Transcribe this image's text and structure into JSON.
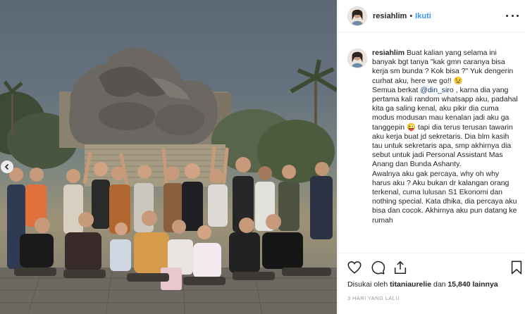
{
  "post": {
    "username": "resiahlim",
    "separator": "•",
    "follow_label": "Ikuti",
    "more_icon": "ellipsis-icon"
  },
  "caption": {
    "username": "resiahlim",
    "p1": " Buat kalian yang selama ini banyak bgt tanya \"kak gmn caranya bisa kerja sm bunda ? Kok bisa ?\" Yuk dengerin curhat aku, here we go!! 😉\nSemua berkat ",
    "mention": "@din_siro",
    "p2": " , karna dia yang pertama kali random whatsapp aku, padahal kita ga saling kenal, aku pikir dia cuma modus modusan mau kenalan jadi aku ga tanggepin 😜 tapi dia terus terusan tawarin aku kerja buat jd sekretaris. Dia blm kasih tau untuk sekretaris apa, smp akhirnya dia sebut untuk jadi Personal Assistant Mas Anang dan Bunda Ashanty.\nAwalnya aku gak percaya, why oh why harus aku ? Aku bukan dr kalangan orang terkenal, cuma lulusan S1 Ekonomi dan nothing special. Kata dhika, dia percaya aku bisa dan cocok. Akhirnya aku pun datang ke rumah"
  },
  "actions": {
    "like_icon": "heart-icon",
    "comment_icon": "comment-icon",
    "share_icon": "share-icon",
    "save_icon": "bookmark-icon"
  },
  "likes": {
    "prefix": "Disukai oleh ",
    "user": "titaniaurelie",
    "middle": " dan ",
    "count": "15,840",
    "suffix": " lainnya"
  },
  "timestamp": "3 HARI YANG LALU",
  "photo": {
    "nav_icon": "chevron-left-icon"
  },
  "colors": {
    "link": "#3897f0",
    "mention": "#003569",
    "muted": "#999999",
    "text": "#262626"
  }
}
